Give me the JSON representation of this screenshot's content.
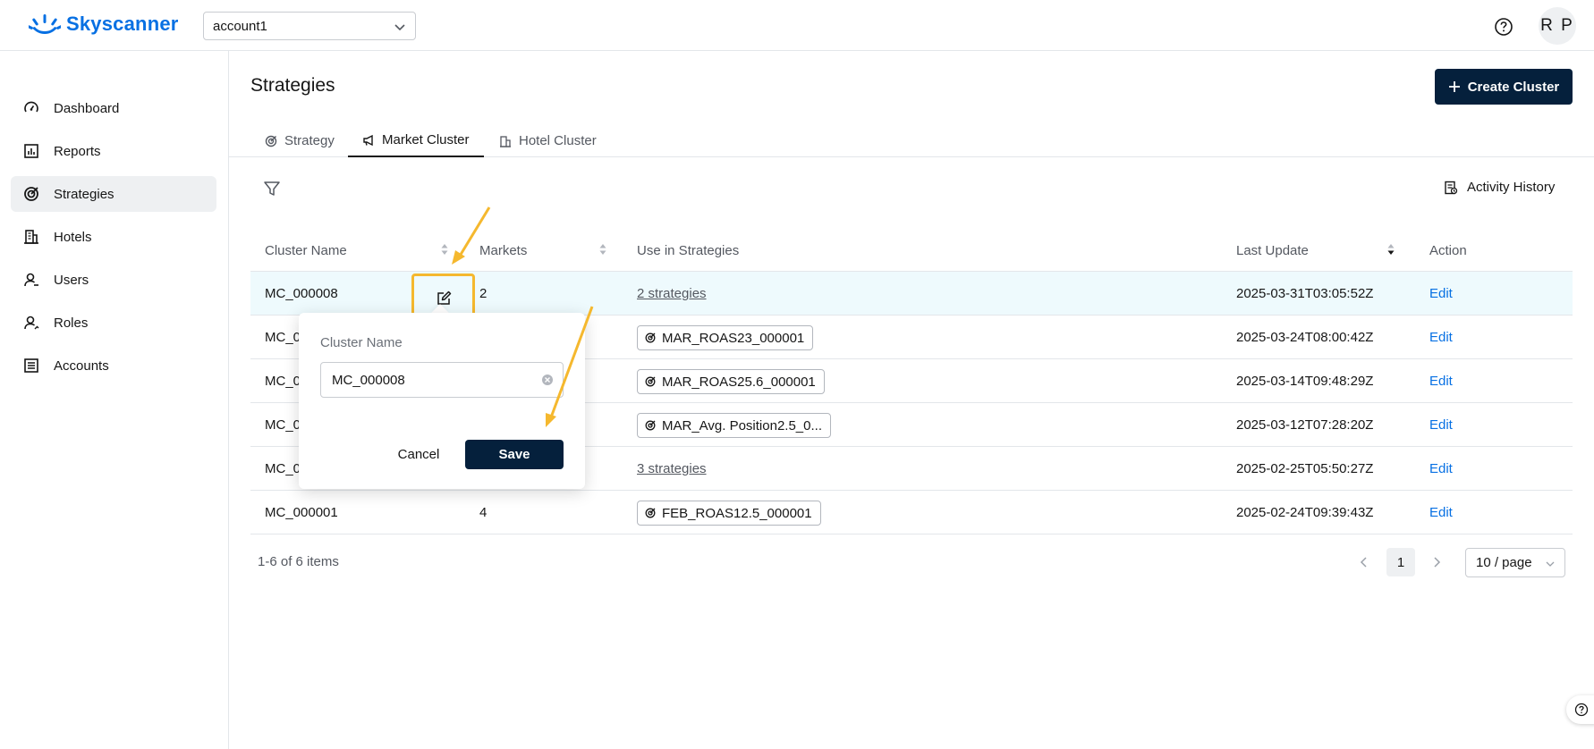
{
  "header": {
    "brand": "Skyscanner",
    "account": "account1",
    "avatar_initials": "R P"
  },
  "sidebar": {
    "items": [
      {
        "label": "Dashboard",
        "icon": "dashboard-icon"
      },
      {
        "label": "Reports",
        "icon": "reports-icon"
      },
      {
        "label": "Strategies",
        "icon": "target-icon",
        "active": true
      },
      {
        "label": "Hotels",
        "icon": "building-icon"
      },
      {
        "label": "Users",
        "icon": "user-icon"
      },
      {
        "label": "Roles",
        "icon": "role-icon"
      },
      {
        "label": "Accounts",
        "icon": "list-icon"
      }
    ]
  },
  "main": {
    "title": "Strategies",
    "create_label": "Create Cluster",
    "tabs": [
      {
        "label": "Strategy"
      },
      {
        "label": "Market Cluster",
        "active": true
      },
      {
        "label": "Hotel Cluster"
      }
    ],
    "activity_label": "Activity History"
  },
  "table": {
    "columns": [
      "Cluster Name",
      "Markets",
      "Use in Strategies",
      "Last Update",
      "Action"
    ],
    "rows": [
      {
        "name": "MC_000008",
        "markets": "2",
        "strategy": "2 strategies",
        "strategy_kind": "link",
        "updated": "2025-03-31T03:05:52Z",
        "action": "Edit"
      },
      {
        "name": "MC_0",
        "markets": "",
        "strategy": "MAR_ROAS23_000001",
        "strategy_kind": "tag",
        "updated": "2025-03-24T08:00:42Z",
        "action": "Edit"
      },
      {
        "name": "MC_0",
        "markets": "",
        "strategy": "MAR_ROAS25.6_000001",
        "strategy_kind": "tag",
        "updated": "2025-03-14T09:48:29Z",
        "action": "Edit"
      },
      {
        "name": "MC_0",
        "markets": "",
        "strategy": "MAR_Avg. Position2.5_0...",
        "strategy_kind": "tag",
        "updated": "2025-03-12T07:28:20Z",
        "action": "Edit"
      },
      {
        "name": "MC_0",
        "markets": "",
        "strategy": "3 strategies",
        "strategy_kind": "link",
        "updated": "2025-02-25T05:50:27Z",
        "action": "Edit"
      },
      {
        "name": "MC_000001",
        "markets": "4",
        "strategy": "FEB_ROAS12.5_000001",
        "strategy_kind": "tag",
        "updated": "2025-02-24T09:39:43Z",
        "action": "Edit"
      }
    ]
  },
  "pagination": {
    "info": "1-6 of 6 items",
    "current_page": "1",
    "page_size": "10 / page"
  },
  "popover": {
    "label": "Cluster Name",
    "value": "MC_000008",
    "cancel_label": "Cancel",
    "save_label": "Save"
  },
  "colors": {
    "brand": "#0770e3",
    "primary_button": "#05203c",
    "annotation": "#f5b82e",
    "row_highlight": "#eefafd"
  }
}
